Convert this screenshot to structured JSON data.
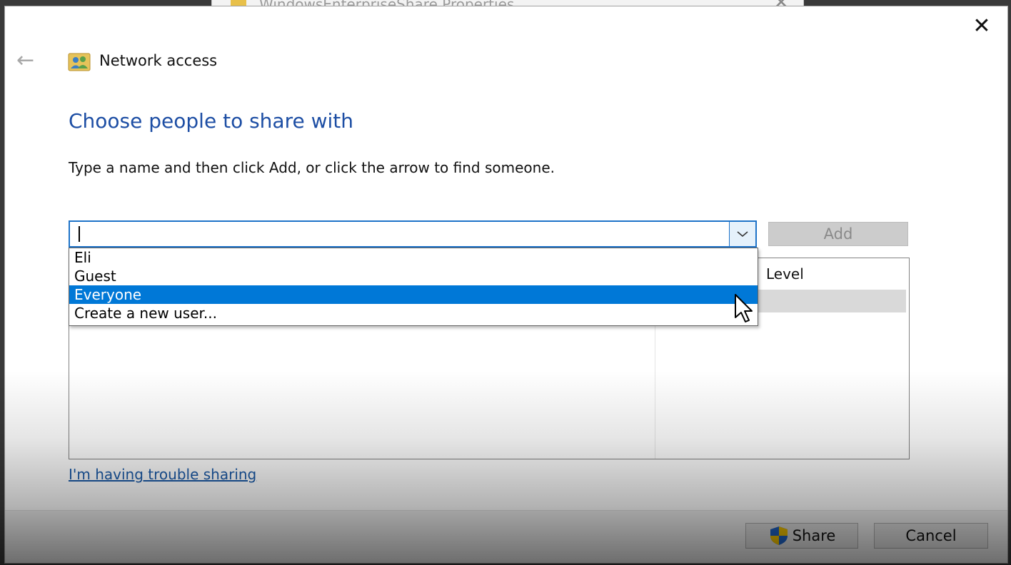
{
  "background_window": {
    "title": "WindowsEnterpriseShare Properties"
  },
  "dialog": {
    "close_label": "✕",
    "back_label": "←",
    "wizard_title": "Network access",
    "heading": "Choose people to share with",
    "instructions": "Type a name and then click Add, or click the arrow to find someone.",
    "name_input_value": "",
    "add_button": "Add",
    "dropdown_options": [
      "Eli",
      "Guest",
      "Everyone",
      "Create a new user..."
    ],
    "selected_option": "Everyone",
    "permission_column_header": "Level",
    "help_link": "I'm having trouble sharing",
    "share_button": "Share",
    "cancel_button": "Cancel"
  },
  "colors": {
    "heading": "#1d4ea4",
    "selection": "#0078d7",
    "link": "#1a5aa8"
  },
  "icons": [
    "back-arrow-icon",
    "network-users-icon",
    "chevron-down-icon",
    "uac-shield-icon",
    "close-icon",
    "mouse-pointer-icon"
  ]
}
